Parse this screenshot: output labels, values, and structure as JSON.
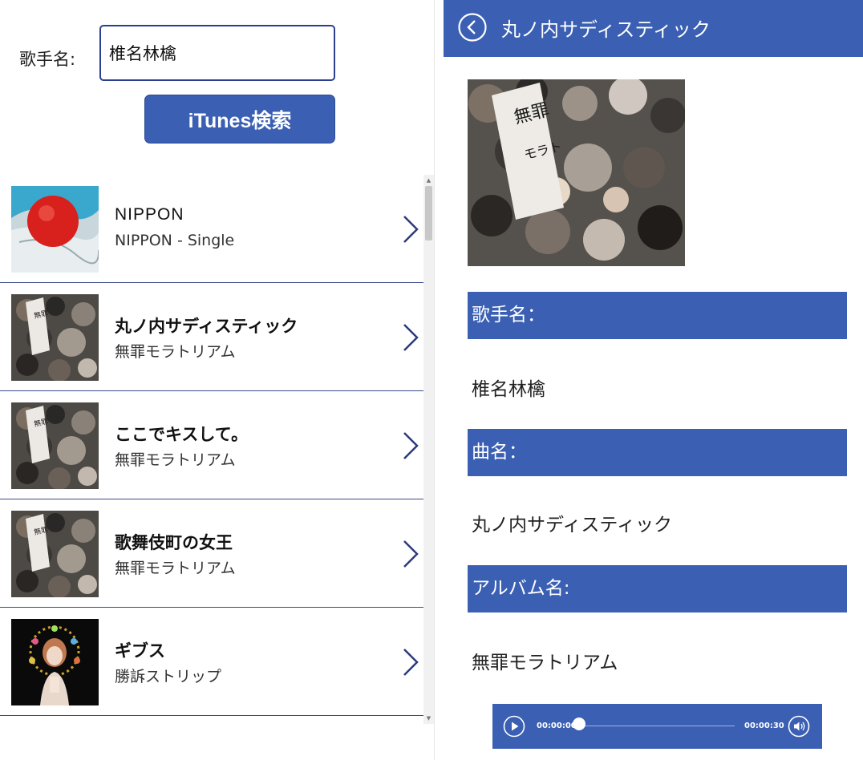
{
  "search": {
    "label": "歌手名:",
    "value": "椎名林檎",
    "button": "iTunes検索"
  },
  "results": [
    {
      "title": "NIPPON",
      "album": "NIPPON - Single",
      "art": "nippon-flag-ball"
    },
    {
      "title": "丸ノ内サディスティック",
      "album": "無罪モラトリアム",
      "art": "crowd-photo"
    },
    {
      "title": "ここでキスして。",
      "album": "無罪モラトリアム",
      "art": "crowd-photo"
    },
    {
      "title": "歌舞伎町の女王",
      "album": "無罪モラトリアム",
      "art": "crowd-photo"
    },
    {
      "title": "ギブス",
      "album": "勝訴ストリップ",
      "art": "flower-portrait"
    }
  ],
  "detail": {
    "header_title": "丸ノ内サディスティック",
    "artist_label": "歌手名：",
    "artist_value": "椎名林檎",
    "song_label": "曲名：",
    "song_value": "丸ノ内サディスティック",
    "album_label": "アルバム名:",
    "album_value": "無罪モラトリアム"
  },
  "player": {
    "current_time": "00:00:00",
    "total_time": "00:00:30",
    "progress": 0
  },
  "colors": {
    "accent": "#3a5fb3",
    "divider": "#3a4a8a"
  }
}
